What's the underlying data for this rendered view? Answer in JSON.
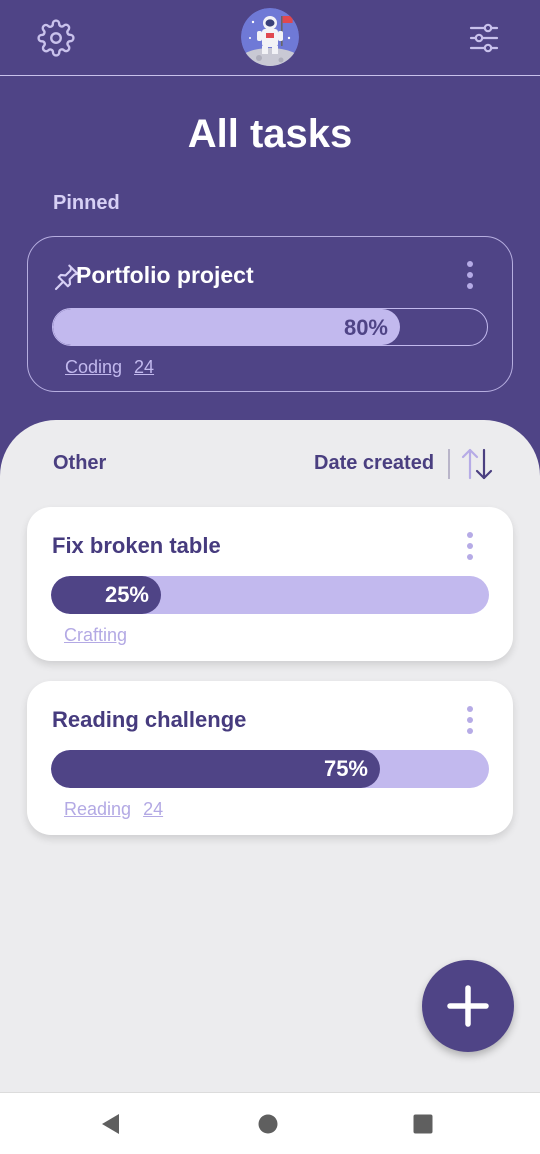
{
  "header": {
    "title": "All tasks",
    "icons": [
      "gear-icon",
      "astronaut-avatar",
      "sliders-icon"
    ]
  },
  "pinned": {
    "section_label": "Pinned",
    "card": {
      "title": "Portfolio project",
      "progress": 0.8,
      "progress_label": "80%",
      "tag": "Coding",
      "count": "24"
    }
  },
  "other": {
    "section_label": "Other",
    "sort_label": "Date created",
    "tasks": [
      {
        "title": "Fix broken table",
        "progress": 0.25,
        "progress_label": "25%",
        "tag": "Crafting",
        "count": ""
      },
      {
        "title": "Reading challenge",
        "progress": 0.75,
        "progress_label": "75%",
        "tag": "Reading",
        "count": "24"
      }
    ]
  },
  "fab": {
    "icon": "plus-icon"
  },
  "system_nav": {
    "icons": [
      "back-triangle-icon",
      "home-circle-icon",
      "recents-square-icon"
    ]
  },
  "colors": {
    "primary": "#4f4486",
    "light_accent": "#c2b9ee",
    "background": "#ececee",
    "card": "#ffffff",
    "muted_text": "#b3a9e4"
  }
}
